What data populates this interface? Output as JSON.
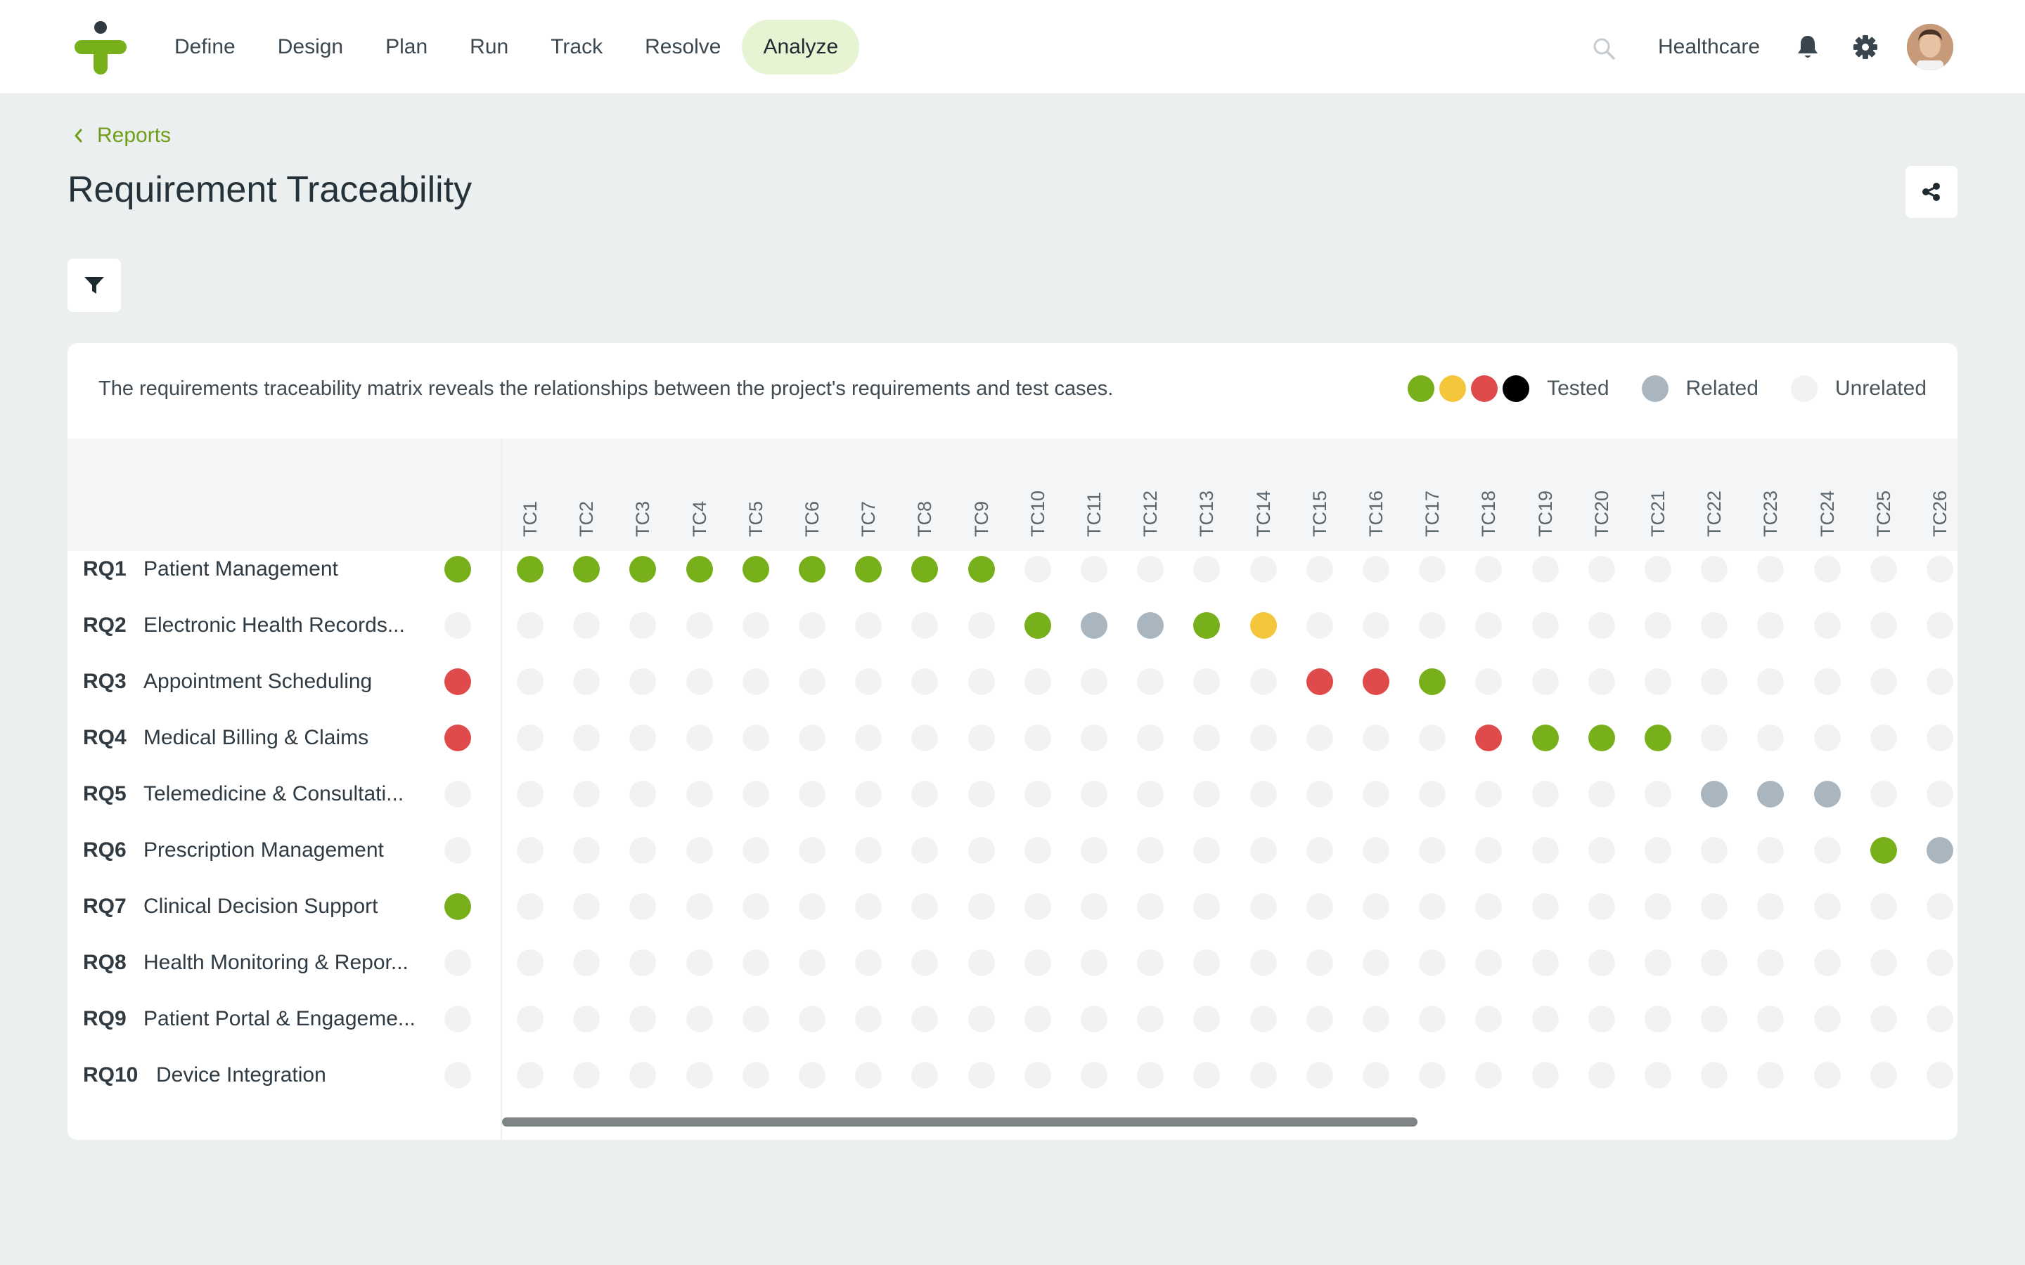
{
  "nav": {
    "items": [
      {
        "label": "Define",
        "active": false
      },
      {
        "label": "Design",
        "active": false
      },
      {
        "label": "Plan",
        "active": false
      },
      {
        "label": "Run",
        "active": false
      },
      {
        "label": "Track",
        "active": false
      },
      {
        "label": "Resolve",
        "active": false
      },
      {
        "label": "Analyze",
        "active": true
      }
    ],
    "workspace": "Healthcare"
  },
  "breadcrumb": {
    "label": "Reports"
  },
  "page": {
    "title": "Requirement Traceability"
  },
  "card": {
    "description": "The requirements traceability matrix reveals the relationships between the project's requirements and test cases.",
    "legend": {
      "tested": "Tested",
      "related": "Related",
      "unrelated": "Unrelated"
    }
  },
  "colors": {
    "accent": "#77b01a",
    "passed": "#77b01a",
    "warning": "#f3c63c",
    "failed": "#df4b4b",
    "blocked": "#000000",
    "related": "#a9b6bf",
    "unrelated": "#f1f2f3"
  },
  "matrix": {
    "test_cases": [
      "TC1",
      "TC2",
      "TC3",
      "TC4",
      "TC5",
      "TC6",
      "TC7",
      "TC8",
      "TC9",
      "TC10",
      "TC11",
      "TC12",
      "TC13",
      "TC14",
      "TC15",
      "TC16",
      "TC17",
      "TC18",
      "TC19",
      "TC20",
      "TC21",
      "TC22",
      "TC23",
      "TC24",
      "TC25",
      "TC26"
    ],
    "requirements": [
      {
        "id": "RQ1",
        "name": "Patient Management",
        "status": "passed",
        "cells": {
          "TC1": "passed",
          "TC2": "passed",
          "TC3": "passed",
          "TC4": "passed",
          "TC5": "passed",
          "TC6": "passed",
          "TC7": "passed",
          "TC8": "passed",
          "TC9": "passed"
        }
      },
      {
        "id": "RQ2",
        "name": "Electronic Health Records...",
        "status": "unrelated",
        "cells": {
          "TC10": "passed",
          "TC11": "related",
          "TC12": "related",
          "TC13": "passed",
          "TC14": "warning"
        }
      },
      {
        "id": "RQ3",
        "name": "Appointment Scheduling",
        "status": "failed",
        "cells": {
          "TC15": "failed",
          "TC16": "failed",
          "TC17": "passed"
        }
      },
      {
        "id": "RQ4",
        "name": "Medical Billing & Claims",
        "status": "failed",
        "cells": {
          "TC18": "failed",
          "TC19": "passed",
          "TC20": "passed",
          "TC21": "passed"
        }
      },
      {
        "id": "RQ5",
        "name": "Telemedicine & Consultati...",
        "status": "unrelated",
        "cells": {
          "TC22": "related",
          "TC23": "related",
          "TC24": "related"
        }
      },
      {
        "id": "RQ6",
        "name": "Prescription Management",
        "status": "unrelated",
        "cells": {
          "TC25": "passed",
          "TC26": "related"
        }
      },
      {
        "id": "RQ7",
        "name": "Clinical Decision Support",
        "status": "passed",
        "cells": {}
      },
      {
        "id": "RQ8",
        "name": "Health Monitoring & Repor...",
        "status": "unrelated",
        "cells": {}
      },
      {
        "id": "RQ9",
        "name": "Patient Portal & Engageme...",
        "status": "unrelated",
        "cells": {}
      },
      {
        "id": "RQ10",
        "name": "Device Integration",
        "status": "unrelated",
        "cells": {}
      }
    ]
  }
}
